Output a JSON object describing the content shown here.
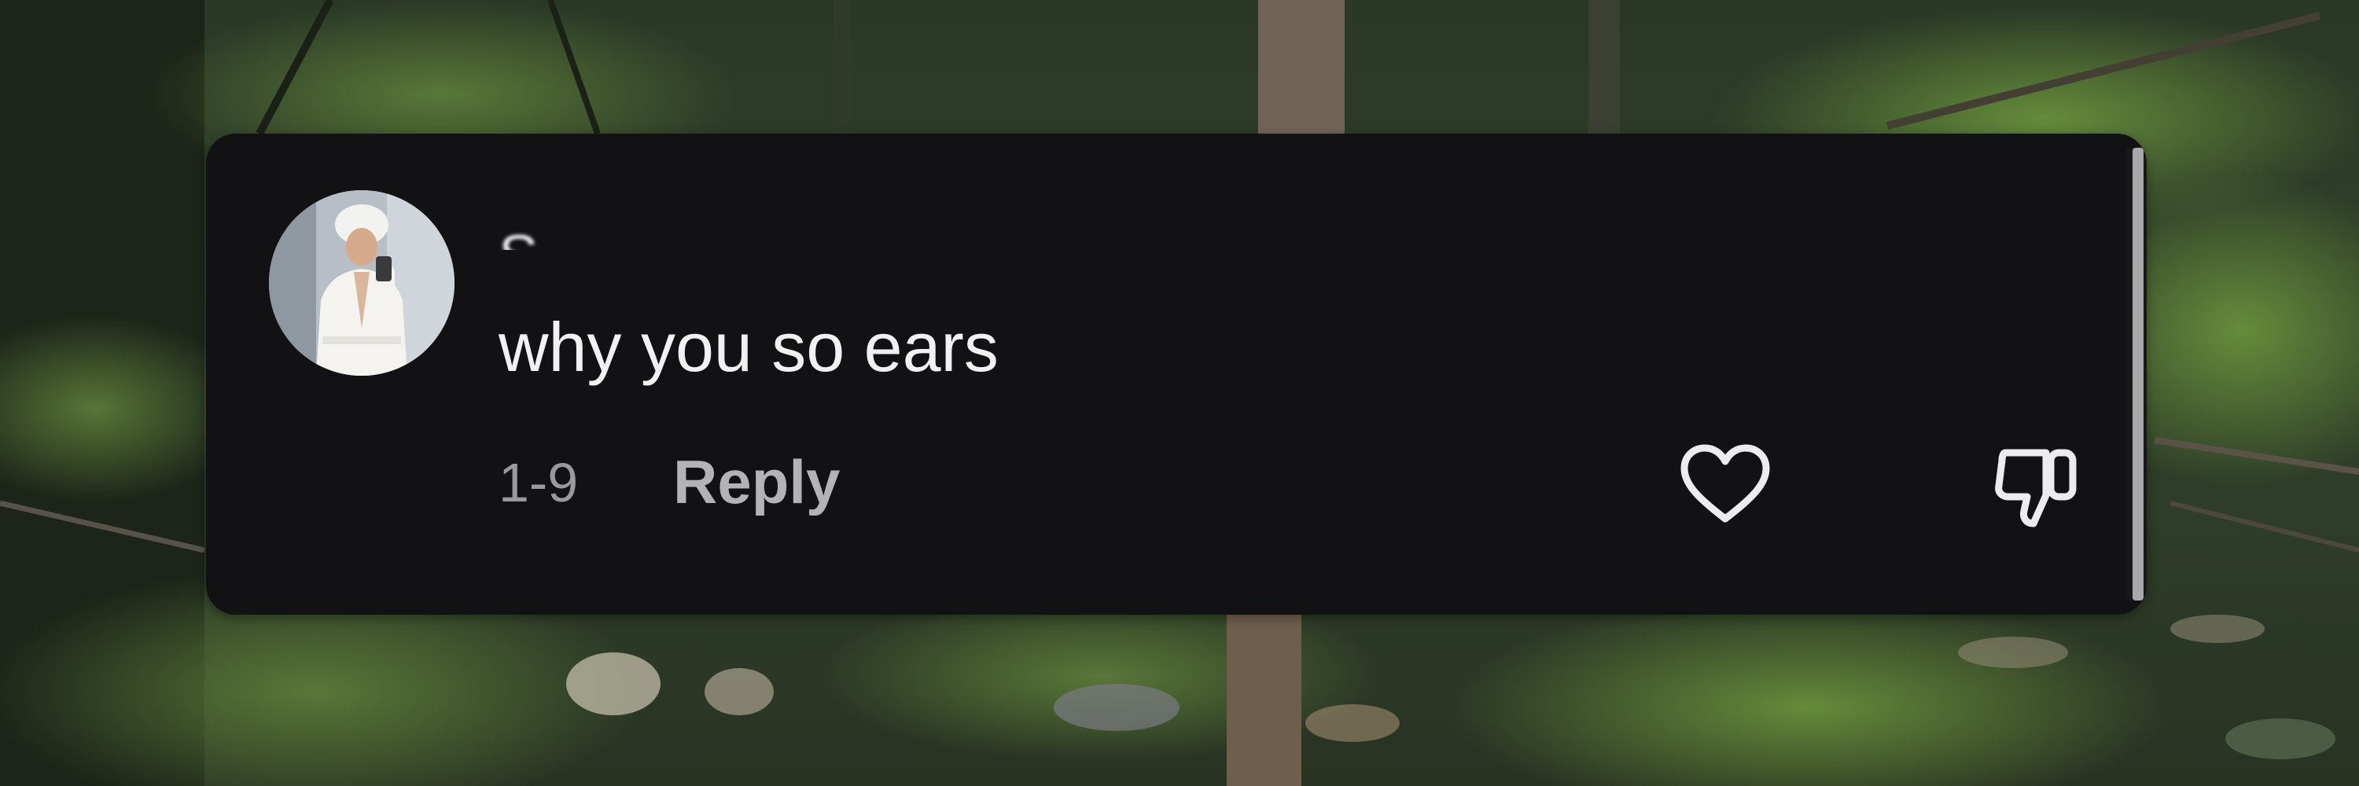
{
  "comment": {
    "username": "S",
    "text": "why you so ears",
    "timestamp": "1-9",
    "reply_label": "Reply",
    "like_icon": "heart-outline-icon",
    "dislike_icon": "thumbs-down-outline-icon"
  },
  "colors": {
    "card_background": "#121113",
    "primary_text": "#f1f0f3",
    "secondary_text": "#9a9a9e",
    "icon": "#ececee"
  }
}
